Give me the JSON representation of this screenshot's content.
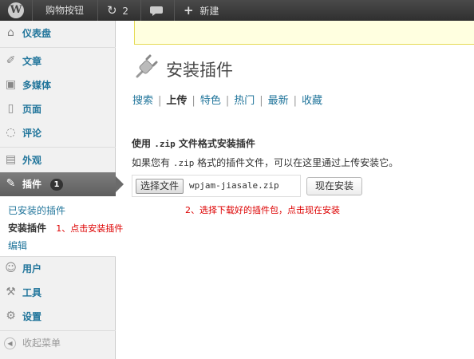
{
  "adminbar": {
    "logo": "W",
    "site_name": "购物按钮",
    "updates_count": "2",
    "new_label": "新建"
  },
  "sidebar": {
    "items": [
      {
        "label": "仪表盘",
        "icon": "dashboard-icon"
      },
      {
        "label": "文章",
        "icon": "pin-icon"
      },
      {
        "label": "多媒体",
        "icon": "media-icon"
      },
      {
        "label": "页面",
        "icon": "page-icon"
      },
      {
        "label": "评论",
        "icon": "comment-icon"
      },
      {
        "label": "外观",
        "icon": "appearance-icon"
      },
      {
        "label": "插件",
        "icon": "plugin-icon",
        "badge": "1"
      },
      {
        "label": "用户",
        "icon": "users-icon"
      },
      {
        "label": "工具",
        "icon": "tools-icon"
      },
      {
        "label": "设置",
        "icon": "settings-icon"
      }
    ],
    "submenu": [
      {
        "label": "已安装的插件"
      },
      {
        "label": "安装插件",
        "note": "1、点击安装插件"
      },
      {
        "label": "编辑"
      }
    ],
    "collapse_label": "收起菜单"
  },
  "main": {
    "title": "安装插件",
    "tabs": [
      "搜索",
      "上传",
      "特色",
      "热门",
      "最新",
      "收藏"
    ],
    "current_tab": "上传",
    "upload_heading_prefix": "使用",
    "upload_heading_code": ".zip",
    "upload_heading_suffix": "文件格式安装插件",
    "upload_desc_prefix": "如果您有",
    "upload_desc_code": ".zip",
    "upload_desc_suffix": "格式的插件文件，可以在这里通过上传安装它。",
    "choose_file_label": "选择文件",
    "file_name": "wpjam-jiasale.zip",
    "install_button_label": "现在安装",
    "hint2": "2、选择下载好的插件包，点击现在安装"
  },
  "colors": {
    "link": "#21759b",
    "annotation": "#dd0000",
    "active_menu": "#6b6b6b"
  }
}
